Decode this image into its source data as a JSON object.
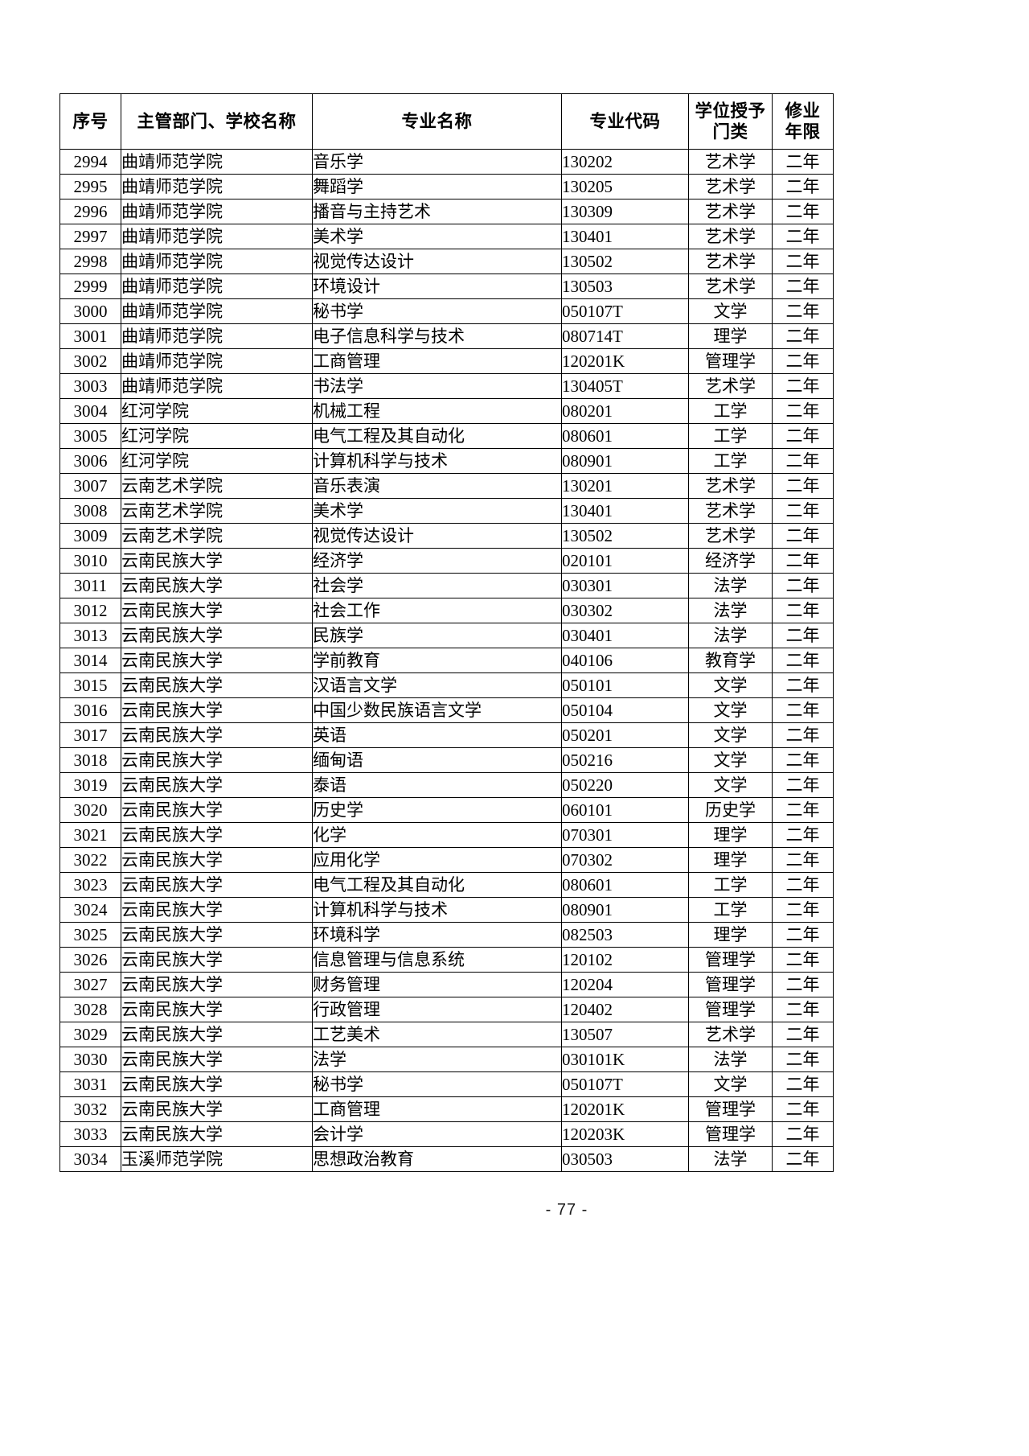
{
  "document": {
    "page_number_label": "- 77 -"
  },
  "table": {
    "headers": [
      {
        "id": "seq",
        "lines": [
          "序号"
        ]
      },
      {
        "id": "school",
        "lines": [
          "主管部门、学校名称"
        ]
      },
      {
        "id": "major",
        "lines": [
          "专业名称"
        ]
      },
      {
        "id": "code",
        "lines": [
          "专业代码"
        ]
      },
      {
        "id": "degree",
        "lines": [
          "学位授予",
          "门类"
        ]
      },
      {
        "id": "years",
        "lines": [
          "修业",
          "年限"
        ]
      }
    ],
    "rows": [
      {
        "seq": "2994",
        "school": "曲靖师范学院",
        "major": "音乐学",
        "code": "130202",
        "degree": "艺术学",
        "years": "二年"
      },
      {
        "seq": "2995",
        "school": "曲靖师范学院",
        "major": "舞蹈学",
        "code": "130205",
        "degree": "艺术学",
        "years": "二年"
      },
      {
        "seq": "2996",
        "school": "曲靖师范学院",
        "major": "播音与主持艺术",
        "code": "130309",
        "degree": "艺术学",
        "years": "二年"
      },
      {
        "seq": "2997",
        "school": "曲靖师范学院",
        "major": "美术学",
        "code": "130401",
        "degree": "艺术学",
        "years": "二年"
      },
      {
        "seq": "2998",
        "school": "曲靖师范学院",
        "major": "视觉传达设计",
        "code": "130502",
        "degree": "艺术学",
        "years": "二年"
      },
      {
        "seq": "2999",
        "school": "曲靖师范学院",
        "major": "环境设计",
        "code": "130503",
        "degree": "艺术学",
        "years": "二年"
      },
      {
        "seq": "3000",
        "school": "曲靖师范学院",
        "major": "秘书学",
        "code": "050107T",
        "degree": "文学",
        "years": "二年"
      },
      {
        "seq": "3001",
        "school": "曲靖师范学院",
        "major": "电子信息科学与技术",
        "code": "080714T",
        "degree": "理学",
        "years": "二年"
      },
      {
        "seq": "3002",
        "school": "曲靖师范学院",
        "major": "工商管理",
        "code": "120201K",
        "degree": "管理学",
        "years": "二年"
      },
      {
        "seq": "3003",
        "school": "曲靖师范学院",
        "major": "书法学",
        "code": "130405T",
        "degree": "艺术学",
        "years": "二年"
      },
      {
        "seq": "3004",
        "school": "红河学院",
        "major": "机械工程",
        "code": "080201",
        "degree": "工学",
        "years": "二年"
      },
      {
        "seq": "3005",
        "school": "红河学院",
        "major": "电气工程及其自动化",
        "code": "080601",
        "degree": "工学",
        "years": "二年"
      },
      {
        "seq": "3006",
        "school": "红河学院",
        "major": "计算机科学与技术",
        "code": "080901",
        "degree": "工学",
        "years": "二年"
      },
      {
        "seq": "3007",
        "school": "云南艺术学院",
        "major": "音乐表演",
        "code": "130201",
        "degree": "艺术学",
        "years": "二年"
      },
      {
        "seq": "3008",
        "school": "云南艺术学院",
        "major": "美术学",
        "code": "130401",
        "degree": "艺术学",
        "years": "二年"
      },
      {
        "seq": "3009",
        "school": "云南艺术学院",
        "major": "视觉传达设计",
        "code": "130502",
        "degree": "艺术学",
        "years": "二年"
      },
      {
        "seq": "3010",
        "school": "云南民族大学",
        "major": "经济学",
        "code": "020101",
        "degree": "经济学",
        "years": "二年"
      },
      {
        "seq": "3011",
        "school": "云南民族大学",
        "major": "社会学",
        "code": "030301",
        "degree": "法学",
        "years": "二年"
      },
      {
        "seq": "3012",
        "school": "云南民族大学",
        "major": "社会工作",
        "code": "030302",
        "degree": "法学",
        "years": "二年"
      },
      {
        "seq": "3013",
        "school": "云南民族大学",
        "major": "民族学",
        "code": "030401",
        "degree": "法学",
        "years": "二年"
      },
      {
        "seq": "3014",
        "school": "云南民族大学",
        "major": "学前教育",
        "code": "040106",
        "degree": "教育学",
        "years": "二年"
      },
      {
        "seq": "3015",
        "school": "云南民族大学",
        "major": "汉语言文学",
        "code": "050101",
        "degree": "文学",
        "years": "二年"
      },
      {
        "seq": "3016",
        "school": "云南民族大学",
        "major": "中国少数民族语言文学",
        "code": "050104",
        "degree": "文学",
        "years": "二年"
      },
      {
        "seq": "3017",
        "school": "云南民族大学",
        "major": "英语",
        "code": "050201",
        "degree": "文学",
        "years": "二年"
      },
      {
        "seq": "3018",
        "school": "云南民族大学",
        "major": "缅甸语",
        "code": "050216",
        "degree": "文学",
        "years": "二年"
      },
      {
        "seq": "3019",
        "school": "云南民族大学",
        "major": "泰语",
        "code": "050220",
        "degree": "文学",
        "years": "二年"
      },
      {
        "seq": "3020",
        "school": "云南民族大学",
        "major": "历史学",
        "code": "060101",
        "degree": "历史学",
        "years": "二年"
      },
      {
        "seq": "3021",
        "school": "云南民族大学",
        "major": "化学",
        "code": "070301",
        "degree": "理学",
        "years": "二年"
      },
      {
        "seq": "3022",
        "school": "云南民族大学",
        "major": "应用化学",
        "code": "070302",
        "degree": "理学",
        "years": "二年"
      },
      {
        "seq": "3023",
        "school": "云南民族大学",
        "major": "电气工程及其自动化",
        "code": "080601",
        "degree": "工学",
        "years": "二年"
      },
      {
        "seq": "3024",
        "school": "云南民族大学",
        "major": "计算机科学与技术",
        "code": "080901",
        "degree": "工学",
        "years": "二年"
      },
      {
        "seq": "3025",
        "school": "云南民族大学",
        "major": "环境科学",
        "code": "082503",
        "degree": "理学",
        "years": "二年"
      },
      {
        "seq": "3026",
        "school": "云南民族大学",
        "major": "信息管理与信息系统",
        "code": "120102",
        "degree": "管理学",
        "years": "二年"
      },
      {
        "seq": "3027",
        "school": "云南民族大学",
        "major": "财务管理",
        "code": "120204",
        "degree": "管理学",
        "years": "二年"
      },
      {
        "seq": "3028",
        "school": "云南民族大学",
        "major": "行政管理",
        "code": "120402",
        "degree": "管理学",
        "years": "二年"
      },
      {
        "seq": "3029",
        "school": "云南民族大学",
        "major": "工艺美术",
        "code": "130507",
        "degree": "艺术学",
        "years": "二年"
      },
      {
        "seq": "3030",
        "school": "云南民族大学",
        "major": "法学",
        "code": "030101K",
        "degree": "法学",
        "years": "二年"
      },
      {
        "seq": "3031",
        "school": "云南民族大学",
        "major": "秘书学",
        "code": "050107T",
        "degree": "文学",
        "years": "二年"
      },
      {
        "seq": "3032",
        "school": "云南民族大学",
        "major": "工商管理",
        "code": "120201K",
        "degree": "管理学",
        "years": "二年"
      },
      {
        "seq": "3033",
        "school": "云南民族大学",
        "major": "会计学",
        "code": "120203K",
        "degree": "管理学",
        "years": "二年"
      },
      {
        "seq": "3034",
        "school": "玉溪师范学院",
        "major": "思想政治教育",
        "code": "030503",
        "degree": "法学",
        "years": "二年"
      }
    ]
  }
}
